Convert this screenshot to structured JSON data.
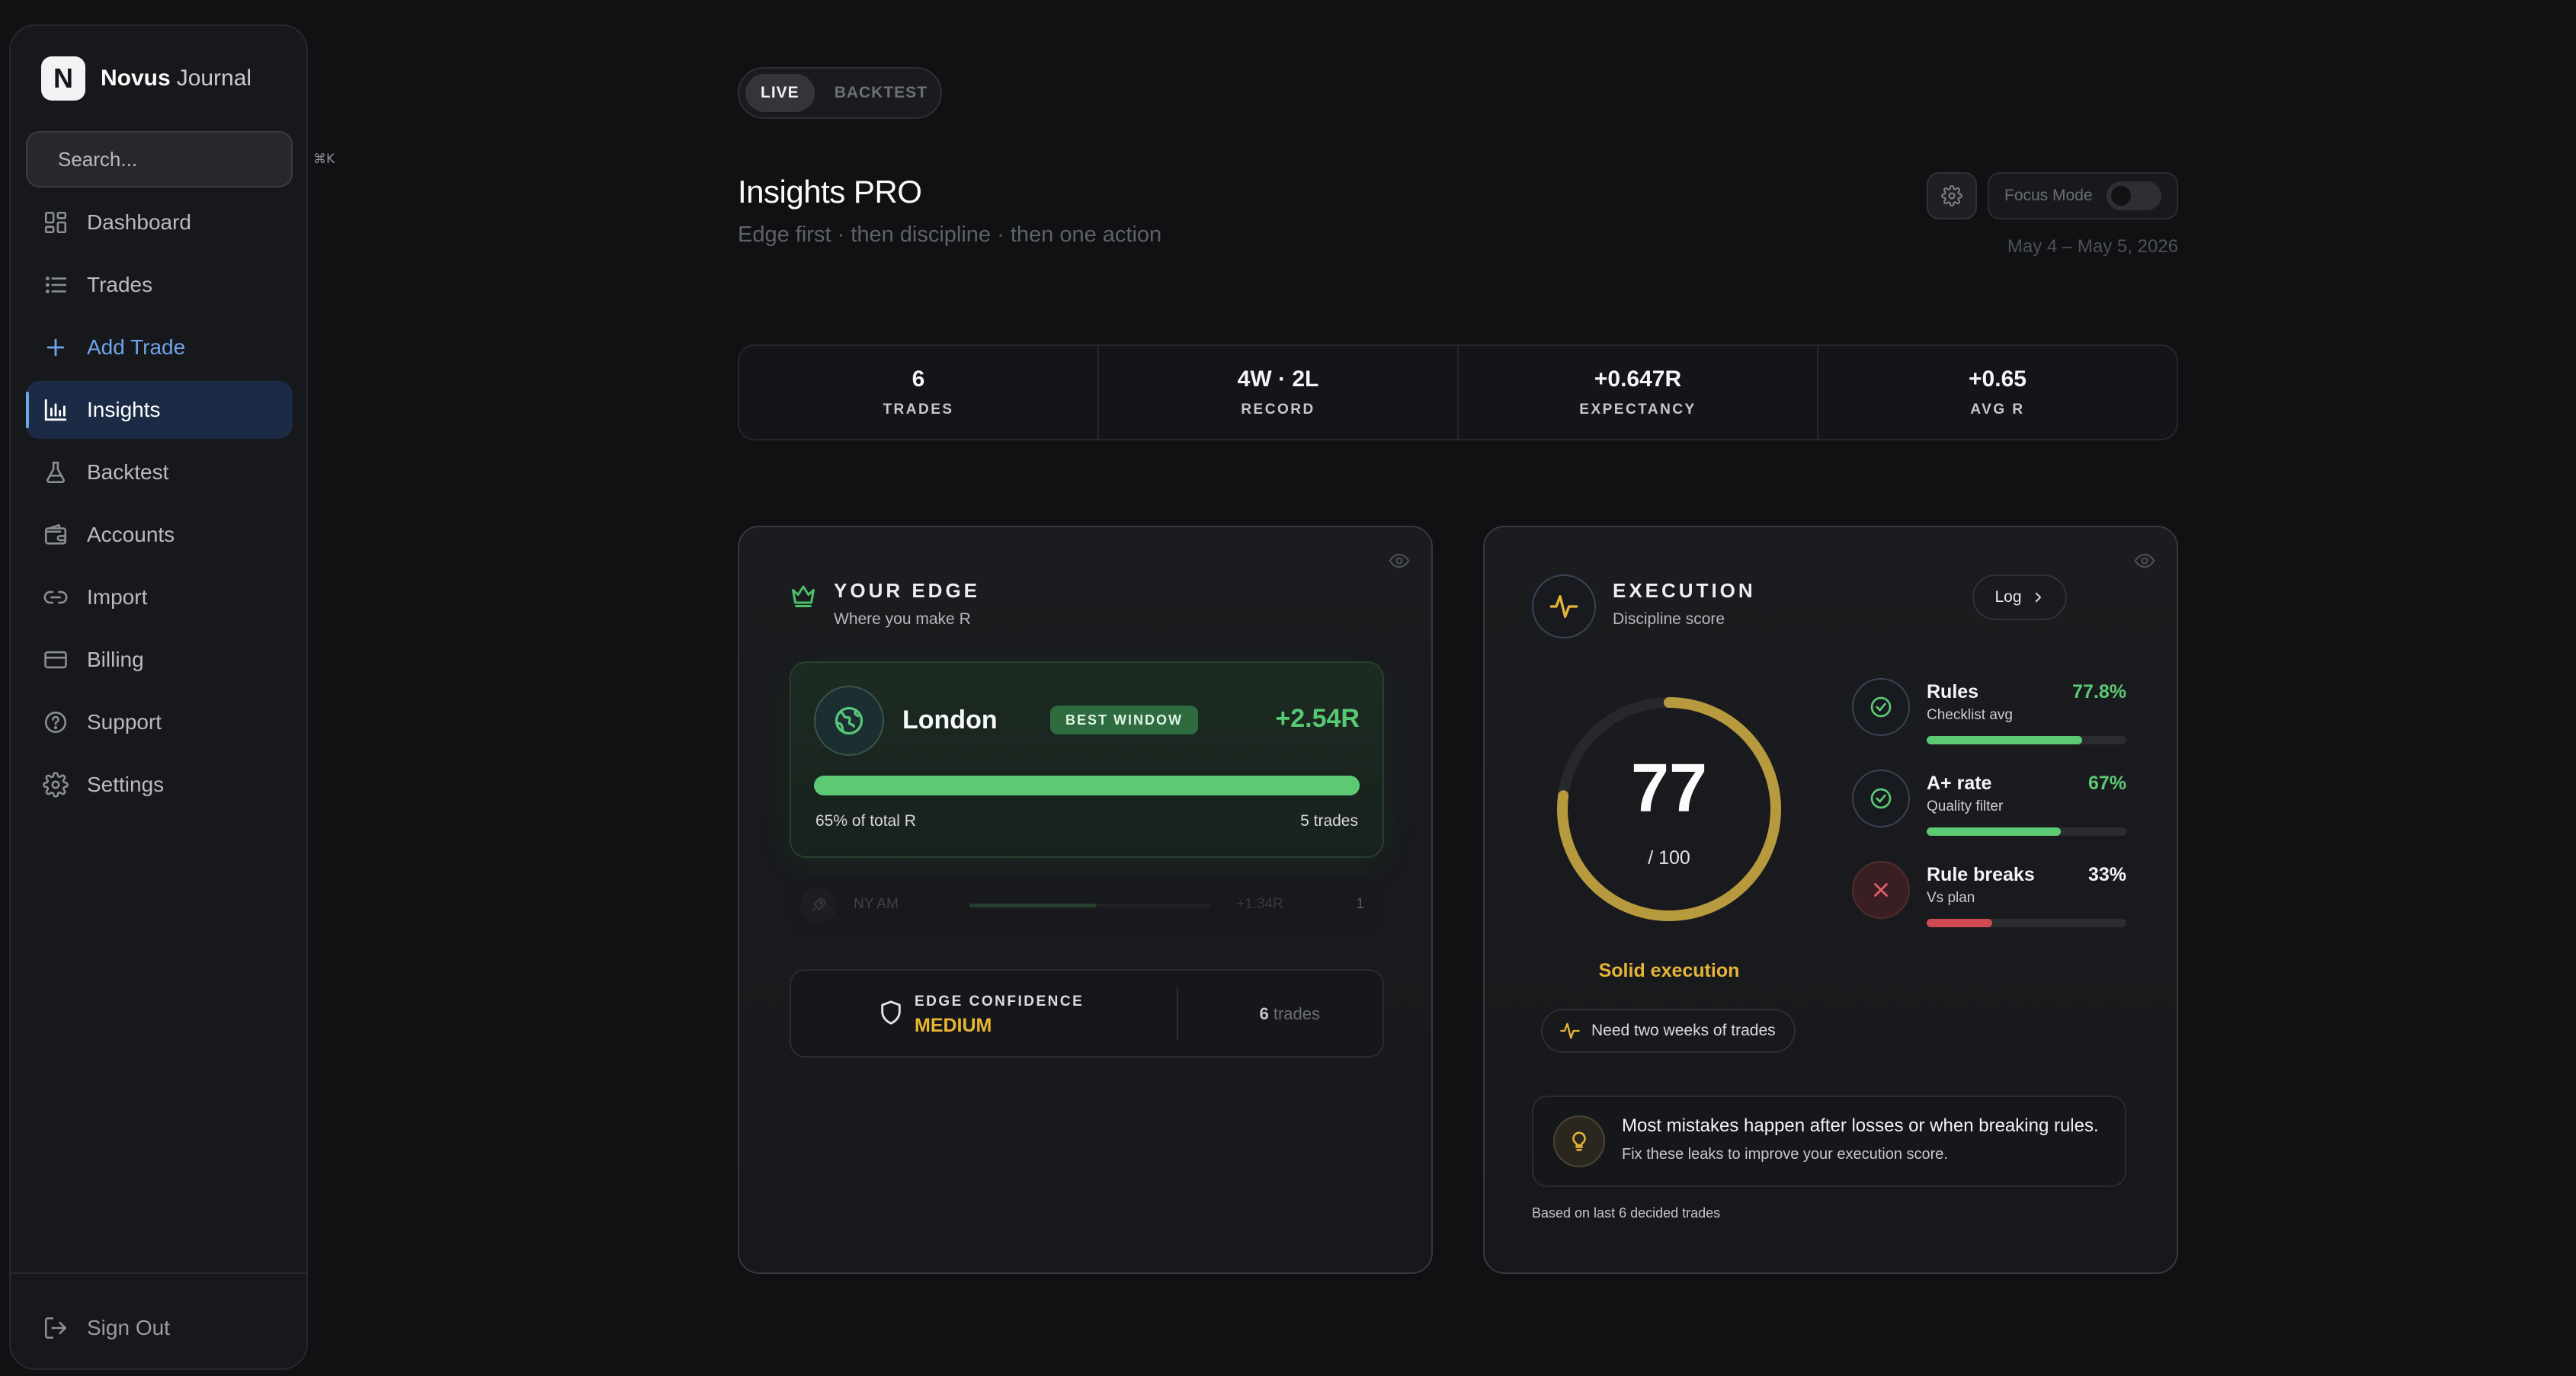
{
  "brand": {
    "name": "Novus",
    "suffix": "Journal",
    "logo_letter": "N"
  },
  "search": {
    "placeholder": "Search...",
    "shortcut": "⌘K"
  },
  "nav": {
    "items": [
      {
        "label": "Dashboard",
        "icon": "grid-icon"
      },
      {
        "label": "Trades",
        "icon": "list-icon"
      },
      {
        "label": "Add Trade",
        "icon": "plus-icon",
        "accent": true
      },
      {
        "label": "Insights",
        "icon": "bar-chart-icon",
        "active": true
      },
      {
        "label": "Backtest",
        "icon": "flask-icon"
      },
      {
        "label": "Accounts",
        "icon": "wallet-icon"
      },
      {
        "label": "Import",
        "icon": "link-icon"
      },
      {
        "label": "Billing",
        "icon": "card-icon"
      },
      {
        "label": "Support",
        "icon": "help-icon"
      },
      {
        "label": "Settings",
        "icon": "gear-icon"
      }
    ],
    "sign_out": "Sign Out"
  },
  "mode": {
    "live": "LIVE",
    "backtest": "BACKTEST",
    "selected": "LIVE"
  },
  "header": {
    "title": "Insights PRO",
    "subtitle": "Edge first · then discipline · then one action",
    "focus_mode_label": "Focus Mode",
    "focus_mode_on": false,
    "date_range": "May 4 – May 5, 2026"
  },
  "stats": [
    {
      "value": "6",
      "label": "TRADES"
    },
    {
      "value": "4W · 2L",
      "label": "RECORD"
    },
    {
      "value": "+0.647R",
      "label": "EXPECTANCY"
    },
    {
      "value": "+0.65",
      "label": "AVG R"
    }
  ],
  "edge": {
    "title": "YOUR EDGE",
    "subtitle": "Where you make R",
    "best": {
      "name": "London",
      "badge": "BEST WINDOW",
      "r": "+2.54R",
      "bar_fraction": 1.0,
      "share": "65% of total R",
      "trades": "5 trades"
    },
    "secondary": {
      "name": "NY AM",
      "r": "+1.34R",
      "count": "1",
      "bar_fraction": 0.53
    },
    "confidence": {
      "label": "EDGE CONFIDENCE",
      "value": "MEDIUM",
      "trades_count": "6",
      "trades_word": "trades"
    }
  },
  "execution": {
    "title": "EXECUTION",
    "subtitle": "Discipline score",
    "log_label": "Log",
    "score": 77,
    "score_display": "77",
    "score_max": "/ 100",
    "verdict": "Solid execution",
    "note": "Need two weeks of trades",
    "metrics": [
      {
        "name": "Rules",
        "sub": "Checklist avg",
        "pct": "77.8%",
        "fraction": 0.778,
        "status": "good"
      },
      {
        "name": "A+ rate",
        "sub": "Quality filter",
        "pct": "67%",
        "fraction": 0.67,
        "status": "good"
      },
      {
        "name": "Rule breaks",
        "sub": "Vs plan",
        "pct": "33%",
        "fraction": 0.33,
        "status": "bad"
      }
    ],
    "tip_main": "Most mistakes happen after losses or when breaking rules.",
    "tip_sub": "Fix these leaks to improve your execution score.",
    "footnote": "Based on last 6 decided trades"
  },
  "colors": {
    "accent_blue": "#6ea5ea",
    "positive_green": "#5cc974",
    "warning_gold": "#e5b53a",
    "negative_red": "#d04a52"
  }
}
